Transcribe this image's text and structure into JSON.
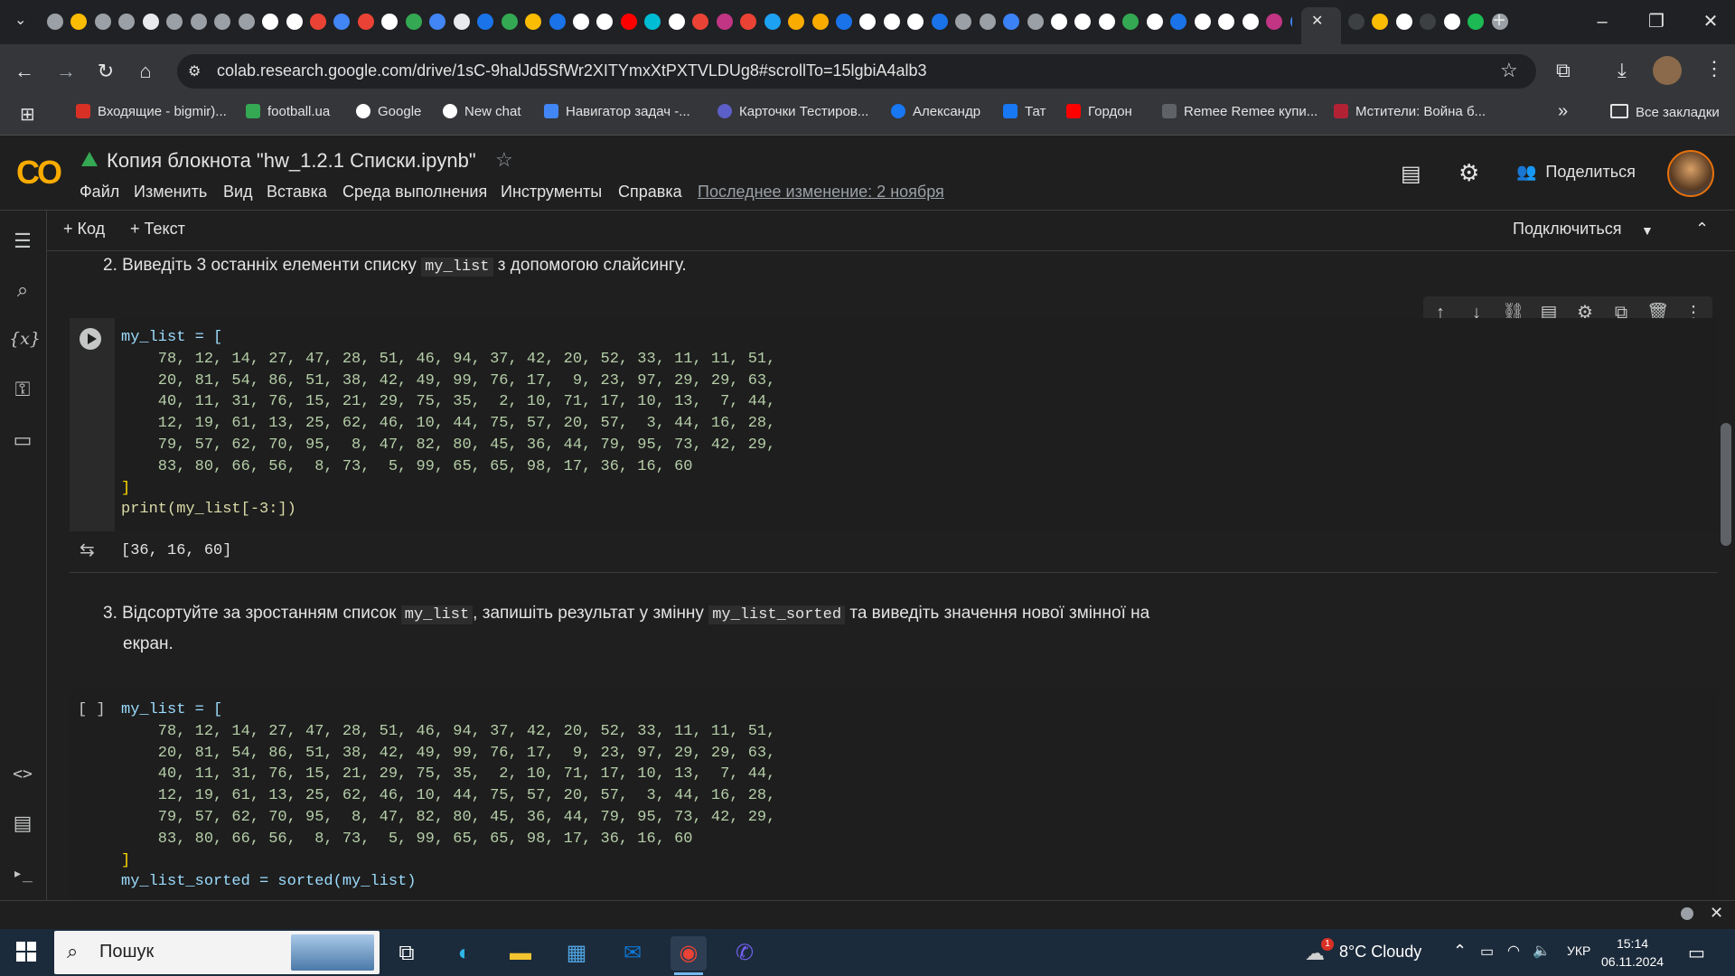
{
  "browser": {
    "url": "colab.research.google.com/drive/1sC-9halJd5SfWr2XITYmxXtPXTVLDUg8#scrollTo=15lgbiA4alb3",
    "tab_close": "✕",
    "new_tab": "+",
    "bookmarks": [
      {
        "label": "Входящие - bigmir)...",
        "color": "#d93025"
      },
      {
        "label": "football.ua",
        "color": "#34a853"
      },
      {
        "label": "Google",
        "color": "#ffffff"
      },
      {
        "label": "New chat",
        "color": "#ffffff"
      },
      {
        "label": "Навигатор задач -...",
        "color": "#4285f4"
      },
      {
        "label": "Карточки Тестиров...",
        "color": "#5b5fc7"
      },
      {
        "label": "Александр",
        "color": "#1877f2"
      },
      {
        "label": "Тат",
        "color": "#1877f2"
      },
      {
        "label": "Гордон",
        "color": "#ff0000"
      },
      {
        "label": "Remee Remee купи...",
        "color": "#5f6368"
      },
      {
        "label": "Мстители: Война б...",
        "color": "#b22234"
      }
    ],
    "more_bookmarks": "»",
    "all_bookmarks": "Все закладки"
  },
  "colab": {
    "logo": "CO",
    "title": "Копия блокнота \"hw_1.2.1 Списки.ipynb\"",
    "menu": [
      "Файл",
      "Изменить",
      "Вид",
      "Вставка",
      "Среда выполнения",
      "Инструменты",
      "Справка"
    ],
    "last_edit": "Последнее изменение: 2 ноября",
    "share": "Поделиться",
    "toolbar": {
      "add_code": "+ Код",
      "add_text": "+ Текст",
      "connect": "Подключиться"
    }
  },
  "cells": {
    "task2": {
      "prefix": "2. Виведіть 3 останніх елементи списку ",
      "code": "my_list",
      "suffix": " з допомогою слайсингу."
    },
    "code1": {
      "list_rows": [
        "    78, 12, 14, 27, 47, 28, 51, 46, 94, 37, 42, 20, 52, 33, 11, 11, 51,",
        "    20, 81, 54, 86, 51, 38, 42, 49, 99, 76, 17,  9, 23, 97, 29, 29, 63,",
        "    40, 11, 31, 76, 15, 21, 29, 75, 35,  2, 10, 71, 17, 10, 13,  7, 44,",
        "    12, 19, 61, 13, 25, 62, 46, 10, 44, 75, 57, 20, 57,  3, 44, 16, 28,",
        "    79, 57, 62, 70, 95,  8, 47, 82, 80, 45, 36, 44, 79, 95, 73, 42, 29,",
        "    83, 80, 66, 56,  8, 73,  5, 99, 65, 65, 98, 17, 36, 16, 60"
      ],
      "open": "my_list = [",
      "close": "]",
      "print": "print(my_list[-3:])",
      "output": "[36, 16, 60]"
    },
    "task3": {
      "prefix": "3. Відсортуйте за зростанням список ",
      "code1": "my_list",
      "middle": ", запишіть результат у змінну ",
      "code2": "my_list_sorted",
      "suffix": " та виведіть значення нової змінної на",
      "line2": "екран."
    },
    "code2": {
      "indicator": "[ ]",
      "open": "my_list = [",
      "close": "]",
      "sorted_line": "my_list_sorted = sorted(my_list)"
    }
  },
  "taskbar": {
    "search": "Пошук",
    "weather": "8°C  Cloudy",
    "weather_badge": "1",
    "lang": "УКР",
    "time": "15:14",
    "date": "06.11.2024"
  }
}
